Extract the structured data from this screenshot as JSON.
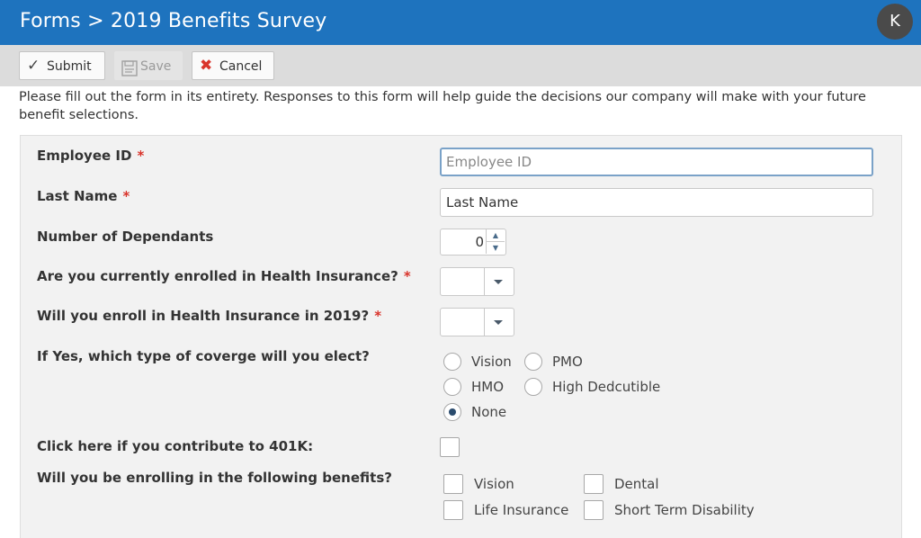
{
  "header": {
    "breadcrumb": "Forms > 2019 Benefits Survey",
    "avatar_initial": "K"
  },
  "toolbar": {
    "submit_label": "Submit",
    "save_label": "Save",
    "cancel_label": "Cancel"
  },
  "intro_text": "Please fill out the form in its entirety. Responses to this form will help guide the decisions our company will make with your future benefit selections.",
  "form": {
    "employee_id": {
      "label": "Employee ID",
      "required_mark": "*",
      "placeholder": "Employee ID",
      "value": ""
    },
    "last_name": {
      "label": "Last Name",
      "required_mark": "*",
      "placeholder": "Last Name",
      "value": ""
    },
    "dependants": {
      "label": "Number of Dependants",
      "value": "0"
    },
    "currently_enrolled": {
      "label": "Are you currently enrolled in Health Insurance?",
      "required_mark": "*",
      "value": ""
    },
    "enroll_2019": {
      "label": "Will you enroll in Health Insurance in 2019?",
      "required_mark": "*",
      "value": ""
    },
    "coverage": {
      "label": "If Yes, which type of coverge will you elect?",
      "options": [
        "Vision",
        "PMO",
        "HMO",
        "High Dedcutible",
        "None"
      ],
      "selected": "None"
    },
    "contrib_401k": {
      "label": "Click here if you contribute to 401K:",
      "checked": false
    },
    "benefits": {
      "label": "Will you be enrolling in the following benefits?",
      "options": [
        "Vision",
        "Dental",
        "Life Insurance",
        "Short Term Disability"
      ],
      "checked": []
    }
  },
  "colors": {
    "header_bg": "#1e73be",
    "toolbar_bg": "#dcdcdc",
    "panel_bg": "#f2f2f2",
    "required": "#d9342b"
  }
}
